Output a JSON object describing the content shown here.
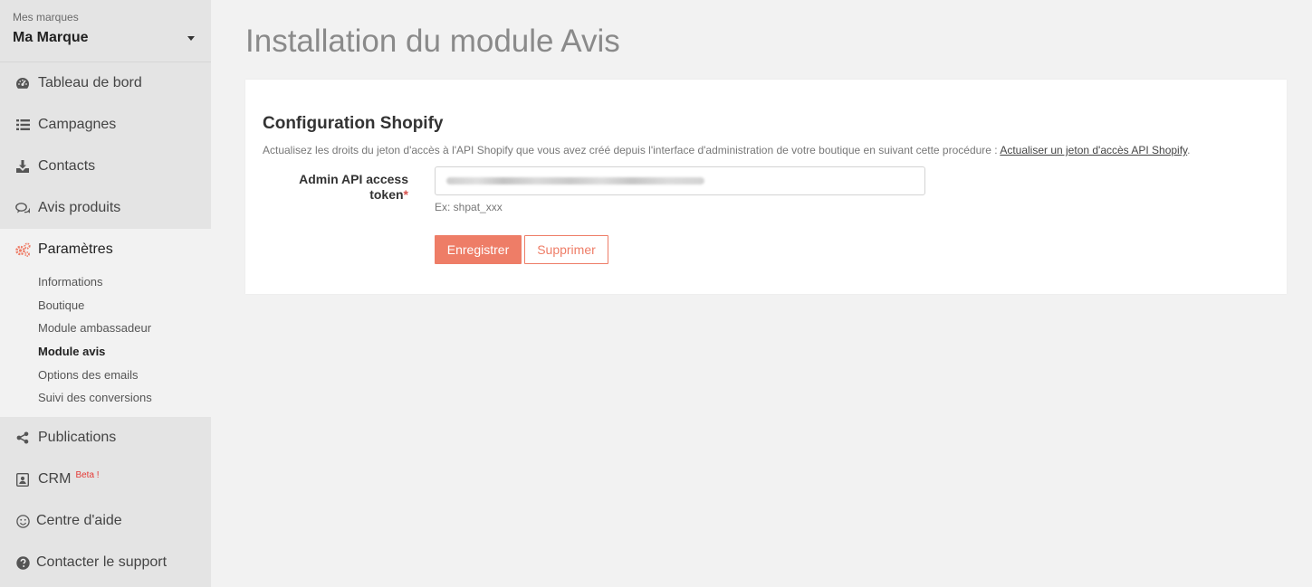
{
  "brand": {
    "caption": "Mes marques",
    "selected": "Ma Marque"
  },
  "nav": {
    "top": [
      {
        "label": "Tableau de bord",
        "icon": "dashboard-icon"
      },
      {
        "label": "Campagnes",
        "icon": "list-icon"
      },
      {
        "label": "Contacts",
        "icon": "download-icon"
      },
      {
        "label": "Avis produits",
        "icon": "comments-icon"
      }
    ],
    "settings": {
      "label": "Paramètres",
      "icon": "cogs-icon",
      "subitems": [
        "Informations",
        "Boutique",
        "Module ambassadeur",
        "Module avis",
        "Options des emails",
        "Suivi des conversions"
      ],
      "current": "Module avis"
    },
    "bottom": [
      {
        "label": "Publications",
        "icon": "share-icon"
      },
      {
        "label": "CRM",
        "icon": "contact-card-icon",
        "badge": "Beta !"
      },
      {
        "label": "Centre d'aide",
        "icon": "smile-icon"
      },
      {
        "label": "Contacter le support",
        "icon": "question-circle-icon"
      }
    ]
  },
  "page": {
    "title": "Installation du module Avis",
    "card": {
      "title": "Configuration Shopify",
      "description": "Actualisez les droits du jeton d'accès à l'API Shopify que vous avez créé depuis l'interface d'administration de votre boutique en suivant cette procédure : ",
      "link": "Actualiser un jeton d'accès API Shopify",
      "description_end": ".",
      "field_label": "Admin API access token",
      "required_mark": "*",
      "field_hint": "Ex: shpat_xxx",
      "save_label": "Enregistrer",
      "delete_label": "Supprimer"
    }
  },
  "colors": {
    "accent": "#ee7d67",
    "sidebar_bg": "#e4e4e4",
    "page_bg": "#f2f2f2",
    "required": "#d9534f",
    "beta": "#e53935"
  }
}
